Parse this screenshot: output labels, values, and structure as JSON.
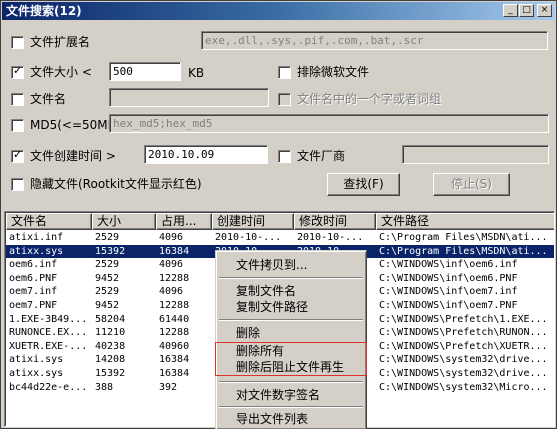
{
  "window": {
    "title": "文件搜索(12)",
    "min": "_",
    "max": "□",
    "close": "×"
  },
  "form": {
    "ext": {
      "label": "文件扩展名",
      "checked": false,
      "value": "exe,.dll,.sys,.pif,.com,.bat,.scr"
    },
    "size": {
      "label": "文件大小 <",
      "checked": true,
      "value": "500",
      "unit": "KB"
    },
    "exclude_ms": {
      "label": "排除微软文件",
      "checked": false
    },
    "name": {
      "label": "文件名",
      "checked": false,
      "value": ""
    },
    "name_part": {
      "label": "文件名中的一个字或者词组",
      "checked": false
    },
    "md5": {
      "label": "MD5(<=50MB):",
      "checked": false,
      "value": "hex_md5;hex_md5"
    },
    "ctime": {
      "label": "文件创建时间 >",
      "checked": true,
      "value": "2010.10.09"
    },
    "vendor": {
      "label": "文件厂商",
      "checked": false,
      "value": ""
    },
    "hidden": {
      "label": "隐藏文件(Rootkit文件显示红色)",
      "checked": false
    },
    "find_button": "查找(F)",
    "stop_button": "停止(S)"
  },
  "table": {
    "columns": [
      "文件名",
      "大小",
      "占用...",
      "创建时间",
      "修改时间",
      "文件路径"
    ],
    "rows": [
      [
        "atixi.inf",
        "2529",
        "4096",
        "2010-10-...",
        "2010-10-...",
        "C:\\Program Files\\MSDN\\ati..."
      ],
      [
        "atixx.sys",
        "15392",
        "16384",
        "2010-10-...",
        "2010-10-...",
        "C:\\Program Files\\MSDN\\ati..."
      ],
      [
        "oem6.inf",
        "2529",
        "4096",
        "",
        "",
        "C:\\WINDOWS\\inf\\oem6.inf"
      ],
      [
        "oem6.PNF",
        "9452",
        "12288",
        "",
        "",
        "C:\\WINDOWS\\inf\\oem6.PNF"
      ],
      [
        "oem7.inf",
        "2529",
        "4096",
        "",
        "",
        "C:\\WINDOWS\\inf\\oem7.inf"
      ],
      [
        "oem7.PNF",
        "9452",
        "12288",
        "",
        "",
        "C:\\WINDOWS\\inf\\oem7.PNF"
      ],
      [
        "1.EXE-3B49...",
        "58204",
        "61440",
        "",
        "",
        "C:\\WINDOWS\\Prefetch\\1.EXE..."
      ],
      [
        "RUNONCE.EX...",
        "11210",
        "12288",
        "",
        "",
        "C:\\WINDOWS\\Prefetch\\RUNON..."
      ],
      [
        "XUETR.EXE-...",
        "40238",
        "40960",
        "",
        "",
        "C:\\WINDOWS\\Prefetch\\XUETR..."
      ],
      [
        "atixi.sys",
        "14208",
        "16384",
        "",
        "",
        "C:\\WINDOWS\\system32\\drive..."
      ],
      [
        "atixx.sys",
        "15392",
        "16384",
        "",
        "",
        "C:\\WINDOWS\\system32\\drive..."
      ],
      [
        "bc44d22e-e...",
        "388",
        "392",
        "",
        "",
        "C:\\WINDOWS\\system32\\Micro..."
      ]
    ],
    "selected_row": 1
  },
  "context_menu": {
    "items": [
      "文件拷贝到...",
      "复制文件名",
      "复制文件路径",
      "删除",
      "删除所有",
      "删除后阻止文件再生",
      "对文件数字签名",
      "导出文件列表"
    ]
  },
  "colors": {
    "title_start": "#0a246a",
    "title_end": "#a6caf0",
    "selection": "#0a246a",
    "highlight_box": "#e03030",
    "face": "#d4d0c8"
  }
}
